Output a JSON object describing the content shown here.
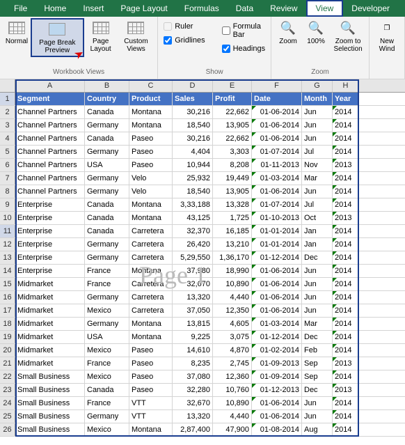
{
  "tabs": [
    "File",
    "Home",
    "Insert",
    "Page Layout",
    "Formulas",
    "Data",
    "Review",
    "View",
    "Developer"
  ],
  "activeTab": "View",
  "ribbon": {
    "views": {
      "label": "Workbook Views",
      "normal": "Normal",
      "pageBreak": "Page Break\nPreview",
      "pageLayout": "Page\nLayout",
      "custom": "Custom\nViews"
    },
    "show": {
      "label": "Show",
      "ruler": "Ruler",
      "formulaBar": "Formula Bar",
      "gridlines": "Gridlines",
      "headings": "Headings"
    },
    "zoom": {
      "label": "Zoom",
      "zoom": "Zoom",
      "hundred": "100%",
      "toSel": "Zoom to\nSelection"
    },
    "window": {
      "new": "New\nWind"
    }
  },
  "watermark": "Page 1",
  "columns": [
    "A",
    "B",
    "C",
    "D",
    "E",
    "F",
    "G",
    "H"
  ],
  "headers": [
    "Segment",
    "Country",
    "Product",
    "Sales",
    "Profit",
    "Date",
    "Month",
    "Year"
  ],
  "rows": [
    [
      "Channel Partners",
      "Canada",
      "Montana",
      "30,216",
      "22,662",
      "01-06-2014",
      "Jun",
      "2014"
    ],
    [
      "Channel Partners",
      "Germany",
      "Montana",
      "18,540",
      "13,905",
      "01-06-2014",
      "Jun",
      "2014"
    ],
    [
      "Channel Partners",
      "Canada",
      "Paseo",
      "30,216",
      "22,662",
      "01-06-2014",
      "Jun",
      "2014"
    ],
    [
      "Channel Partners",
      "Germany",
      "Paseo",
      "4,404",
      "3,303",
      "01-07-2014",
      "Jul",
      "2014"
    ],
    [
      "Channel Partners",
      "USA",
      "Paseo",
      "10,944",
      "8,208",
      "01-11-2013",
      "Nov",
      "2013"
    ],
    [
      "Channel Partners",
      "Germany",
      "Velo",
      "25,932",
      "19,449",
      "01-03-2014",
      "Mar",
      "2014"
    ],
    [
      "Channel Partners",
      "Germany",
      "Velo",
      "18,540",
      "13,905",
      "01-06-2014",
      "Jun",
      "2014"
    ],
    [
      "Enterprise",
      "Canada",
      "Montana",
      "3,33,188",
      "13,328",
      "01-07-2014",
      "Jul",
      "2014"
    ],
    [
      "Enterprise",
      "Canada",
      "Montana",
      "43,125",
      "1,725",
      "01-10-2013",
      "Oct",
      "2013"
    ],
    [
      "Enterprise",
      "Canada",
      "Carretera",
      "32,370",
      "16,185",
      "01-01-2014",
      "Jan",
      "2014"
    ],
    [
      "Enterprise",
      "Germany",
      "Carretera",
      "26,420",
      "13,210",
      "01-01-2014",
      "Jan",
      "2014"
    ],
    [
      "Enterprise",
      "Germany",
      "Carretera",
      "5,29,550",
      "1,36,170",
      "01-12-2014",
      "Dec",
      "2014"
    ],
    [
      "Enterprise",
      "France",
      "Montana",
      "37,980",
      "18,990",
      "01-06-2014",
      "Jun",
      "2014"
    ],
    [
      "Midmarket",
      "France",
      "Carretera",
      "32,670",
      "10,890",
      "01-06-2014",
      "Jun",
      "2014"
    ],
    [
      "Midmarket",
      "Germany",
      "Carretera",
      "13,320",
      "4,440",
      "01-06-2014",
      "Jun",
      "2014"
    ],
    [
      "Midmarket",
      "Mexico",
      "Carretera",
      "37,050",
      "12,350",
      "01-06-2014",
      "Jun",
      "2014"
    ],
    [
      "Midmarket",
      "Germany",
      "Montana",
      "13,815",
      "4,605",
      "01-03-2014",
      "Mar",
      "2014"
    ],
    [
      "Midmarket",
      "USA",
      "Montana",
      "9,225",
      "3,075",
      "01-12-2014",
      "Dec",
      "2014"
    ],
    [
      "Midmarket",
      "Mexico",
      "Paseo",
      "14,610",
      "4,870",
      "01-02-2014",
      "Feb",
      "2014"
    ],
    [
      "Midmarket",
      "France",
      "Paseo",
      "8,235",
      "2,745",
      "01-09-2013",
      "Sep",
      "2013"
    ],
    [
      "Small Business",
      "Mexico",
      "Paseo",
      "37,080",
      "12,360",
      "01-09-2014",
      "Sep",
      "2014"
    ],
    [
      "Small Business",
      "Canada",
      "Paseo",
      "32,280",
      "10,760",
      "01-12-2013",
      "Dec",
      "2013"
    ],
    [
      "Small Business",
      "France",
      "VTT",
      "32,670",
      "10,890",
      "01-06-2014",
      "Jun",
      "2014"
    ],
    [
      "Small Business",
      "Germany",
      "VTT",
      "13,320",
      "4,440",
      "01-06-2014",
      "Jun",
      "2014"
    ],
    [
      "Small Business",
      "Mexico",
      "Montana",
      "2,87,400",
      "47,900",
      "01-08-2014",
      "Aug",
      "2014"
    ]
  ]
}
